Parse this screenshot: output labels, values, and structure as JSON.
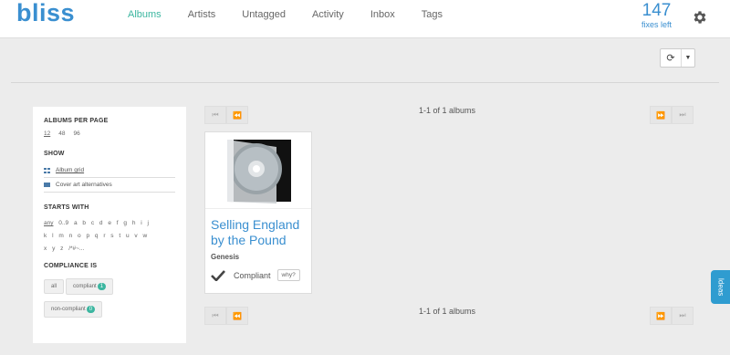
{
  "app": {
    "logo": "bliss"
  },
  "nav": {
    "items": [
      {
        "label": "Albums",
        "active": true
      },
      {
        "label": "Artists",
        "active": false
      },
      {
        "label": "Untagged",
        "active": false
      },
      {
        "label": "Activity",
        "active": false
      },
      {
        "label": "Inbox",
        "active": false
      },
      {
        "label": "Tags",
        "active": false
      }
    ]
  },
  "fixes": {
    "count": "147",
    "label": "fixes left"
  },
  "pagination": {
    "summary_top": "1-1 of 1 albums",
    "summary_bottom": "1-1 of 1 albums"
  },
  "sidebar": {
    "albums_per_page_title": "ALBUMS PER PAGE",
    "per_page_options": [
      "12",
      "48",
      "96"
    ],
    "show_title": "SHOW",
    "show_grid": "Album grid",
    "show_cover": "Cover art alternatives",
    "starts_with_title": "STARTS WITH",
    "letters_line1": [
      "any",
      "0..9",
      "a",
      "b",
      "c",
      "d",
      "e",
      "f",
      "g",
      "h",
      "i",
      "j"
    ],
    "letters_line2": [
      "k",
      "l",
      "m",
      "n",
      "o",
      "p",
      "q",
      "r",
      "s",
      "t",
      "u",
      "v",
      "w"
    ],
    "letters_line3": [
      "x",
      "y",
      "z",
      "/*#~..."
    ],
    "compliance_title": "COMPLIANCE IS",
    "compliance_all": "all",
    "compliance_compliant": "compliant",
    "compliance_compliant_count": "1",
    "compliance_non_compliant": "non-compliant",
    "compliance_non_compliant_count": "0"
  },
  "album": {
    "title": "Selling England by the Pound",
    "artist": "Genesis",
    "status": "Compliant",
    "why_label": "why?"
  },
  "ideas_tab": "Ideas",
  "colors": {
    "brand": "#3a8fd0",
    "accent": "#3cb6a0"
  }
}
